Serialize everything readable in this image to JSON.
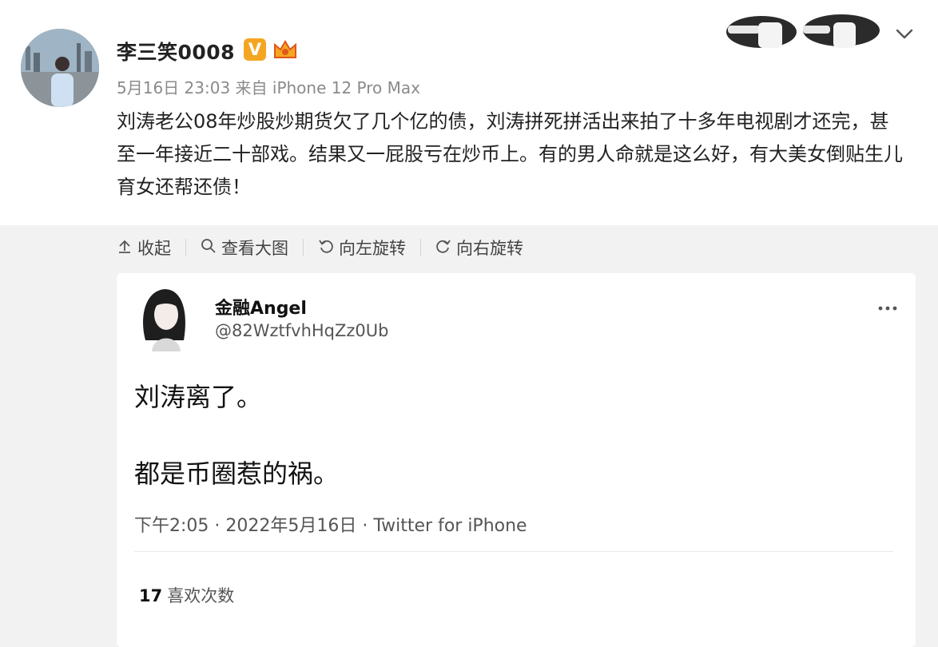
{
  "post": {
    "username": "李三笑0008",
    "verified_badge": "V",
    "crown_icon": "crown-icon",
    "timestamp": "5月16日 23:03",
    "source": "来自 iPhone 12 Pro Max",
    "body": "刘涛老公08年炒股炒期货欠了几个亿的债，刘涛拼死拼活出来拍了十多年电视剧才还完，甚至一年接近二十部戏。结果又一屁股亏在炒币上。有的男人命就是这么好，有大美女倒贴生儿育女还帮还债！",
    "accent_color": "#f4a623"
  },
  "actions": [
    {
      "icon": "collapse-icon",
      "label": "收起"
    },
    {
      "icon": "search-icon",
      "label": "查看大图"
    },
    {
      "icon": "rotate-left-icon",
      "label": "向左旋转"
    },
    {
      "icon": "rotate-right-icon",
      "label": "向右旋转"
    }
  ],
  "tweet": {
    "name": "金融Angel",
    "handle": "@82WztfvhHqZz0Ub",
    "line1": "刘涛离了。",
    "line2": "都是币圈惹的祸。",
    "time": "下午2:05 · 2022年5月16日 · Twitter for iPhone",
    "likes_count": "17",
    "likes_label": "喜欢次数"
  }
}
